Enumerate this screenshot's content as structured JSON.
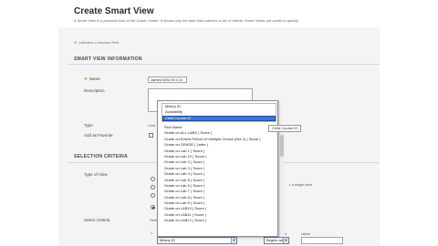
{
  "page": {
    "title": "Create Smart View",
    "intro": "A Smart View is a personal look at the Grade Center. It shows only the data that matches a set of criteria. Smart Views are useful in quickly",
    "required_note": "Indicates a required field."
  },
  "smart_view_info": {
    "heading": "SMART VIEW INFORMATION",
    "name_label": "Name",
    "name_value": "James 5352 III 6 10",
    "description_label": "Description",
    "type_label": "Type",
    "type_value": "Cust",
    "favorite_label": "Add as Favorite"
  },
  "selection_criteria": {
    "heading": "SELECTION CRITERIA",
    "type_of_view_label": "Type of View",
    "type_of_view_note": "r a single item",
    "select_criteria_label": "Select Criteria",
    "select_criteria_value": "Selec",
    "row_number": "1",
    "criteria_select": "Mtiany ID",
    "operator_select": "Begins with",
    "value_label": "Value",
    "operator_label": "n"
  },
  "dropdown": {
    "first_items": [
      "Mtiany ID",
      "Availability",
      "Child Course ID"
    ],
    "selected_index": 2,
    "tooltip": "Child Course ID",
    "items": [
      "First Name",
      "Grade on ALL LABS ( Score )",
      "Grade on Extent Period 10 Multiple Choice (Not 2) ( Score )",
      "Grade on GRADE ( Letter )",
      "Grade on Lab 1 ( Score )",
      "Grade on Lab 10 ( Score )",
      "Grade on Lab 2 ( Score )",
      "Grade on Lab 3 ( Score )",
      "Grade on Lab 4 ( Score )",
      "Grade on Lab 5 ( Score )",
      "Grade on Lab 6 ( Score )",
      "Grade on Lab 7 ( Score )",
      "Grade on Lab 8 ( Score )",
      "Grade on Lab 9 ( Score )",
      "Grade on LAB10 ( Score )",
      "Grade on LAB11 ( Score )",
      "Grade on LAB12 ( Score )"
    ]
  },
  "colors": {
    "accent_required": "#e8a020",
    "selection": "#3776d4",
    "page_bg": "#f4f4f4"
  }
}
